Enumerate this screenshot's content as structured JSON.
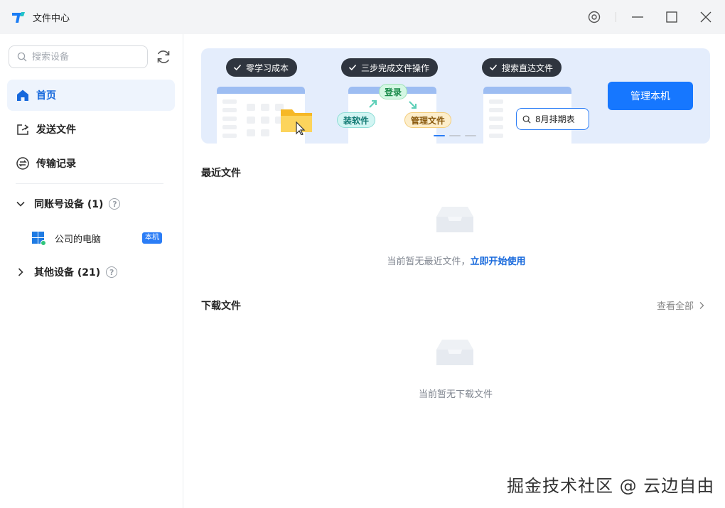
{
  "window": {
    "title": "文件中心"
  },
  "sidebar": {
    "search_placeholder": "搜索设备",
    "nav": [
      {
        "label": "首页",
        "active": true
      },
      {
        "label": "发送文件",
        "active": false
      },
      {
        "label": "传输记录",
        "active": false
      }
    ],
    "groups": [
      {
        "label": "同账号设备 (1)",
        "expanded": true,
        "devices": [
          {
            "name": "公司的电脑",
            "badge": "本机"
          }
        ]
      },
      {
        "label": "其他设备 (21)",
        "expanded": false
      }
    ]
  },
  "banner": {
    "steps": [
      "零学习成本",
      "三步完成文件操作",
      "搜索直达文件"
    ],
    "tags": [
      "登录",
      "装软件",
      "管理文件"
    ],
    "search_example": "8月排期表",
    "slide_index": 1,
    "slide_count": 3,
    "manage_button": "管理本机"
  },
  "recent": {
    "title": "最近文件",
    "empty_text": "当前暂无最近文件，",
    "empty_link": "立即开始使用"
  },
  "downloads": {
    "title": "下载文件",
    "view_all": "查看全部",
    "empty_text": "当前暂无下载文件"
  },
  "watermark": "掘金技术社区 @ 云边自由",
  "colors": {
    "accent": "#1677ff",
    "banner_bg": "#e4edfc",
    "sidebar_active_bg": "#eef4fd",
    "pill_bg": "#2f353f"
  }
}
